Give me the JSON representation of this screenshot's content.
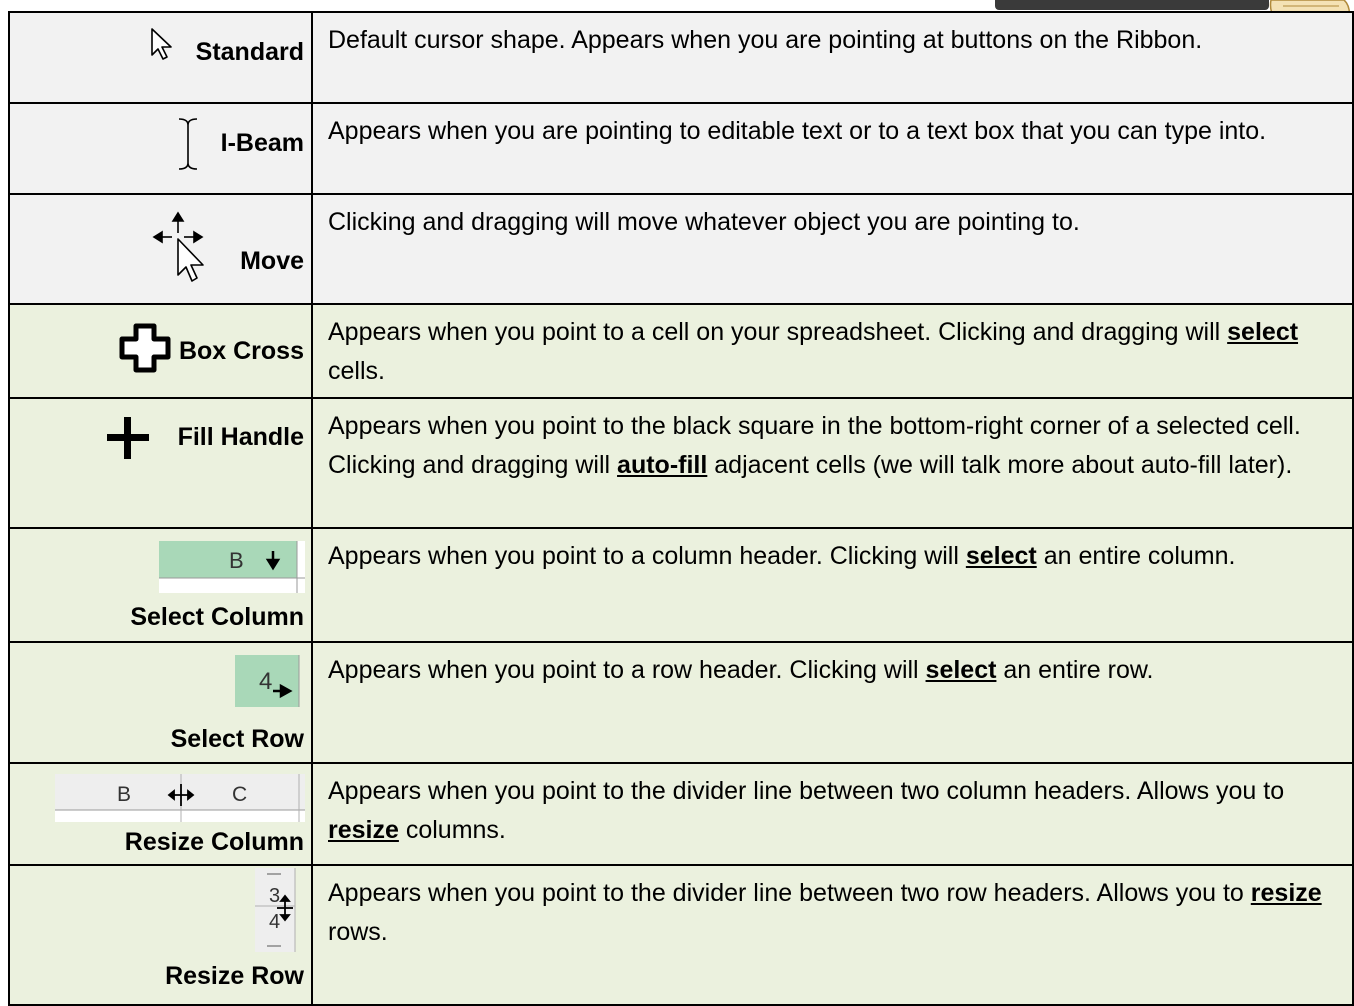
{
  "cursors": [
    {
      "name": "Standard",
      "desc": [
        "Default cursor shape. Appears when you are pointing at buttons on the Ribbon."
      ],
      "icon": "arrow-pointer-icon"
    },
    {
      "name": "I-Beam",
      "desc": [
        "Appears when you are pointing to editable text or to a text box that you can type into."
      ],
      "icon": "i-beam-icon"
    },
    {
      "name": "Move",
      "desc": [
        "Clicking and dragging will move whatever object you are pointing to."
      ],
      "icon": "move-icon"
    },
    {
      "name": "Box Cross",
      "desc": [
        "Appears when you point to a cell on your spreadsheet.  Clicking and dragging will ",
        "select",
        " cells."
      ],
      "icon": "box-cross-icon"
    },
    {
      "name": "Fill Handle",
      "desc": [
        "Appears when you point to the black square in the bottom-right corner of a selected cell.  Clicking and dragging will ",
        "auto-fill",
        " adjacent cells (we will talk more about auto-fill later)."
      ],
      "icon": "plus-icon"
    },
    {
      "name": "Select Column",
      "desc": [
        "Appears when you point to a column header.  Clicking will ",
        "select",
        " an entire column."
      ],
      "icon": "select-column-icon",
      "icon_text": "B"
    },
    {
      "name": "Select Row",
      "desc": [
        "Appears when you point to a row header.  Clicking will ",
        "select",
        " an entire row."
      ],
      "icon": "select-row-icon",
      "icon_text": "4"
    },
    {
      "name": "Resize Column",
      "desc": [
        "Appears when you point to the divider line between two column headers.  Allows you to ",
        "resize",
        " columns."
      ],
      "icon": "resize-column-icon",
      "icon_text": [
        "B",
        "C"
      ]
    },
    {
      "name": "Resize Row",
      "desc": [
        "Appears when you point to the divider line between two row headers.  Allows you to ",
        "resize",
        " rows."
      ],
      "icon": "resize-row-icon",
      "icon_text": [
        "3",
        "4"
      ]
    }
  ],
  "colors": {
    "grey_row": "#f2f2f2",
    "green_row": "#ebf1de",
    "header_green": "#a9d8b8"
  }
}
